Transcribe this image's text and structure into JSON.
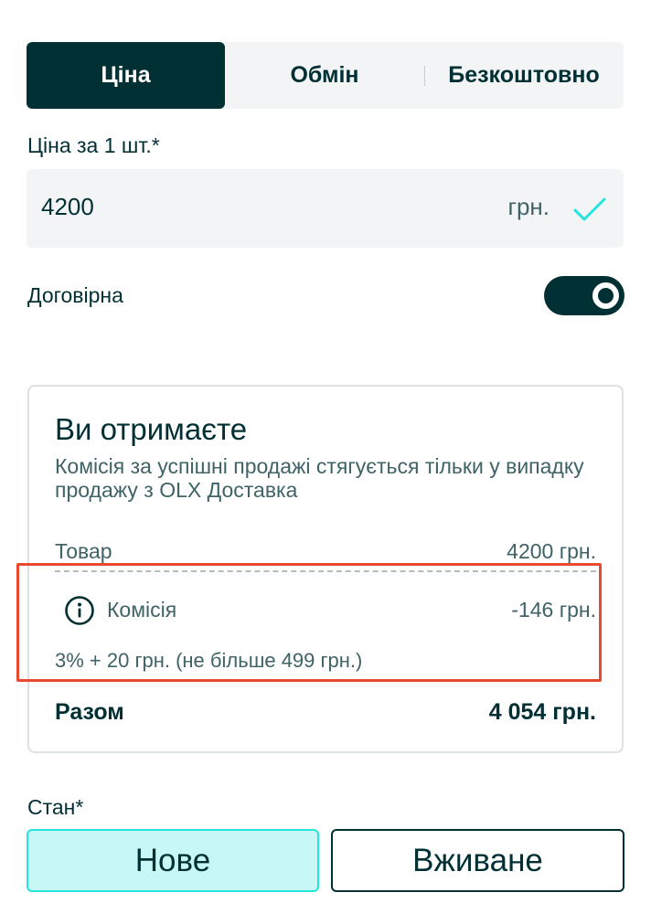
{
  "tabs": [
    {
      "label": "Ціна",
      "active": true
    },
    {
      "label": "Обмін",
      "active": false
    },
    {
      "label": "Безкоштовно",
      "active": false
    }
  ],
  "price": {
    "label": "Ціна за 1 шт.*",
    "value": "4200",
    "currency": "грн.",
    "valid_icon": "check-icon"
  },
  "negotiable": {
    "label": "Договірна",
    "enabled": true
  },
  "earnings": {
    "title": "Ви отримаєте",
    "description": "Комісія за успішні продажі стягується тільки у випадку продажу з OLX Доставка",
    "product_label": "Товар",
    "product_value": "4200 грн.",
    "commission_label": "Комісія",
    "commission_value": "-146 грн.",
    "commission_formula": "3% + 20 грн. (не більше 499 грн.)",
    "total_label": "Разом",
    "total_value": "4 054 грн."
  },
  "condition": {
    "label": "Стан*",
    "options": [
      {
        "label": "Нове",
        "selected": true
      },
      {
        "label": "Вживане",
        "selected": false
      }
    ]
  },
  "colors": {
    "primary": "#002f34",
    "accent": "#23e5db",
    "highlight": "#e94a2e"
  }
}
